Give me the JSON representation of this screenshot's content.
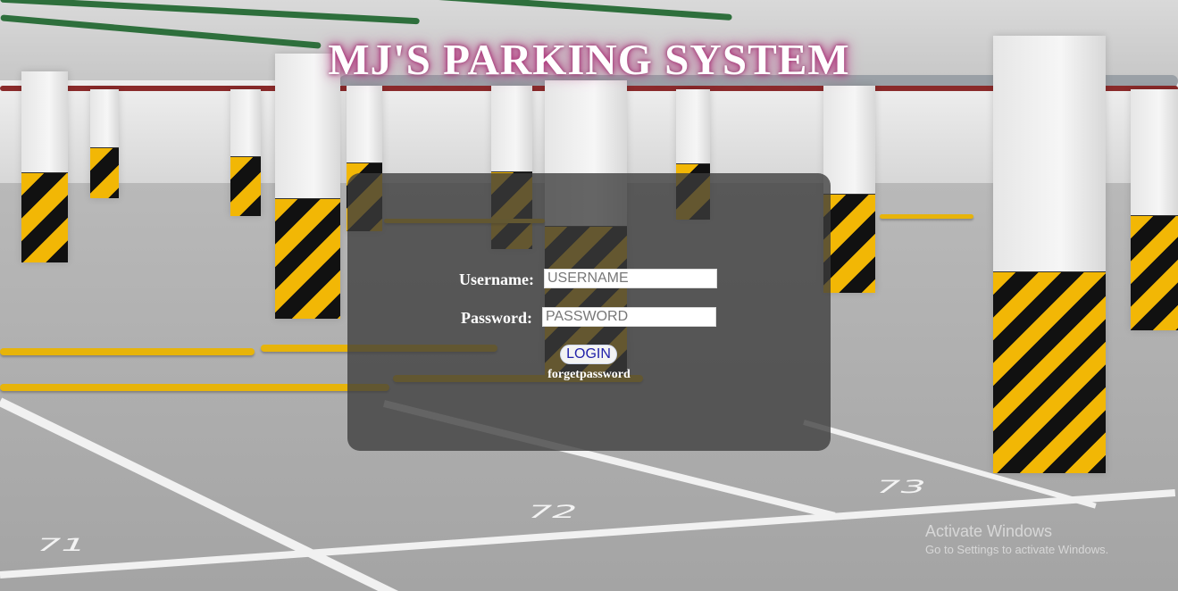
{
  "header": {
    "title": "MJ'S PARKING SYSTEM"
  },
  "login_form": {
    "username_label": "Username:",
    "username_placeholder": "USERNAME",
    "password_label": "Password:",
    "password_placeholder": "PASSWORD",
    "login_button": "LOGIN",
    "forgot_link": "forgetpassword"
  },
  "background": {
    "lot_numbers": [
      "71",
      "72",
      "73"
    ]
  },
  "watermark": {
    "line1": "Activate Windows",
    "line2": "Go to Settings to activate Windows."
  },
  "colors": {
    "title_glow": "#c45d9a",
    "panel": "#3c3c3c",
    "stripe_yellow": "#f2b705",
    "stripe_black": "#111111"
  }
}
